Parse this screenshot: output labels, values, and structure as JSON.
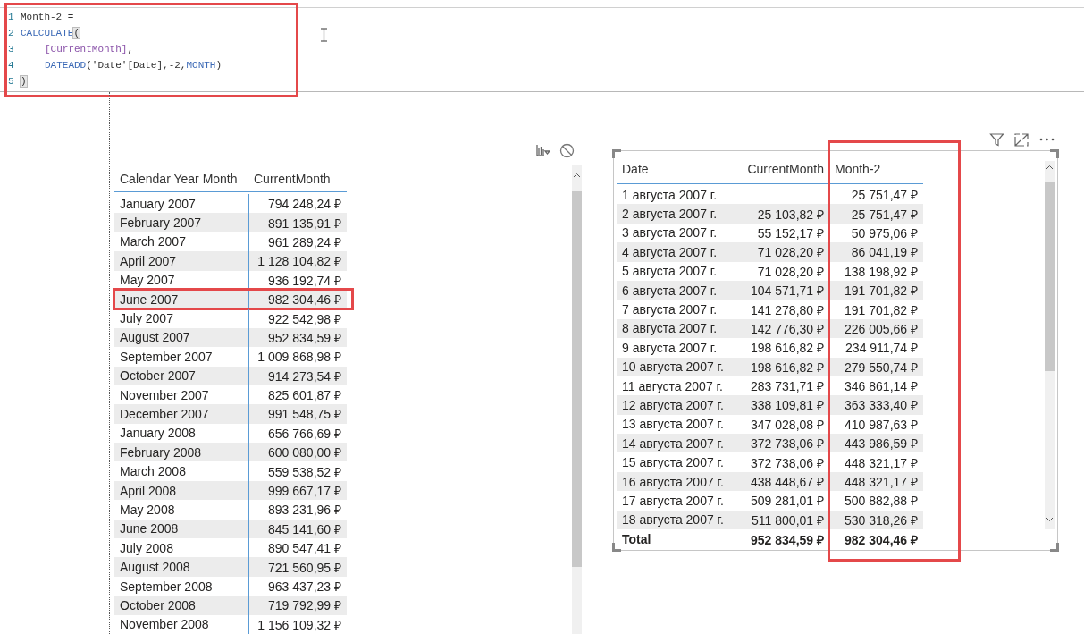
{
  "formula": {
    "highlighted": true,
    "lines": [
      {
        "number": "1",
        "indented": false,
        "tokens": [
          {
            "text": "Month-2 =",
            "kind": "plain"
          }
        ]
      },
      {
        "number": "2",
        "indented": false,
        "tokens": [
          {
            "text": "CALCULATE",
            "kind": "function"
          },
          {
            "text": "(",
            "kind": "bracket"
          }
        ]
      },
      {
        "number": "3",
        "indented": true,
        "tokens": [
          {
            "text": "[CurrentMonth]",
            "kind": "measure"
          },
          {
            "text": ",",
            "kind": "plain"
          }
        ]
      },
      {
        "number": "4",
        "indented": true,
        "tokens": [
          {
            "text": "DATEADD",
            "kind": "function"
          },
          {
            "text": "('Date'[Date],-2,",
            "kind": "plain"
          },
          {
            "text": "MONTH",
            "kind": "keyword"
          },
          {
            "text": ")",
            "kind": "plain"
          }
        ]
      },
      {
        "number": "5",
        "indented": false,
        "tokens": [
          {
            "text": ")",
            "kind": "bracket"
          }
        ]
      }
    ]
  },
  "left_table": {
    "columns": [
      "Calendar Year Month",
      "CurrentMonth"
    ],
    "rows": [
      {
        "cells": [
          "January 2007",
          "794 248,24 ₽"
        ],
        "highlighted": false
      },
      {
        "cells": [
          "February 2007",
          "891 135,91 ₽"
        ],
        "highlighted": false
      },
      {
        "cells": [
          "March 2007",
          "961 289,24 ₽"
        ],
        "highlighted": false
      },
      {
        "cells": [
          "April 2007",
          "1 128 104,82 ₽"
        ],
        "highlighted": false
      },
      {
        "cells": [
          "May 2007",
          "936 192,74 ₽"
        ],
        "highlighted": false
      },
      {
        "cells": [
          "June 2007",
          "982 304,46 ₽"
        ],
        "highlighted": true
      },
      {
        "cells": [
          "July 2007",
          "922 542,98 ₽"
        ],
        "highlighted": false
      },
      {
        "cells": [
          "August 2007",
          "952 834,59 ₽"
        ],
        "highlighted": false
      },
      {
        "cells": [
          "September 2007",
          "1 009 868,98 ₽"
        ],
        "highlighted": false
      },
      {
        "cells": [
          "October 2007",
          "914 273,54 ₽"
        ],
        "highlighted": false
      },
      {
        "cells": [
          "November 2007",
          "825 601,87 ₽"
        ],
        "highlighted": false
      },
      {
        "cells": [
          "December 2007",
          "991 548,75 ₽"
        ],
        "highlighted": false
      },
      {
        "cells": [
          "January 2008",
          "656 766,69 ₽"
        ],
        "highlighted": false
      },
      {
        "cells": [
          "February 2008",
          "600 080,00 ₽"
        ],
        "highlighted": false
      },
      {
        "cells": [
          "March 2008",
          "559 538,52 ₽"
        ],
        "highlighted": false
      },
      {
        "cells": [
          "April 2008",
          "999 667,17 ₽"
        ],
        "highlighted": false
      },
      {
        "cells": [
          "May 2008",
          "893 231,96 ₽"
        ],
        "highlighted": false
      },
      {
        "cells": [
          "June 2008",
          "845 141,60 ₽"
        ],
        "highlighted": false
      },
      {
        "cells": [
          "July 2008",
          "890 547,41 ₽"
        ],
        "highlighted": false
      },
      {
        "cells": [
          "August 2008",
          "721 560,95 ₽"
        ],
        "highlighted": false
      },
      {
        "cells": [
          "September 2008",
          "963 437,23 ₽"
        ],
        "highlighted": false
      },
      {
        "cells": [
          "October 2008",
          "719 792,99 ₽"
        ],
        "highlighted": false
      },
      {
        "cells": [
          "November 2008",
          "1 156 109,32 ₽"
        ],
        "highlighted": false
      }
    ]
  },
  "right_table": {
    "columns": [
      {
        "label": "Date",
        "highlighted": false
      },
      {
        "label": "CurrentMonth",
        "highlighted": false
      },
      {
        "label": "Month-2",
        "highlighted": true
      }
    ],
    "rows": [
      [
        "1 августа 2007 г.",
        "",
        "25 751,47 ₽"
      ],
      [
        "2 августа 2007 г.",
        "25 103,82 ₽",
        "25 751,47 ₽"
      ],
      [
        "3 августа 2007 г.",
        "55 152,17 ₽",
        "50 975,06 ₽"
      ],
      [
        "4 августа 2007 г.",
        "71 028,20 ₽",
        "86 041,19 ₽"
      ],
      [
        "5 августа 2007 г.",
        "71 028,20 ₽",
        "138 198,92 ₽"
      ],
      [
        "6 августа 2007 г.",
        "104 571,71 ₽",
        "191 701,82 ₽"
      ],
      [
        "7 августа 2007 г.",
        "141 278,80 ₽",
        "191 701,82 ₽"
      ],
      [
        "8 августа 2007 г.",
        "142 776,30 ₽",
        "226 005,66 ₽"
      ],
      [
        "9 августа 2007 г.",
        "198 616,82 ₽",
        "234 911,74 ₽"
      ],
      [
        "10 августа 2007 г.",
        "198 616,82 ₽",
        "279 550,74 ₽"
      ],
      [
        "11 августа 2007 г.",
        "283 731,71 ₽",
        "346 861,14 ₽"
      ],
      [
        "12 августа 2007 г.",
        "338 109,81 ₽",
        "363 333,40 ₽"
      ],
      [
        "13 августа 2007 г.",
        "347 028,08 ₽",
        "410 987,63 ₽"
      ],
      [
        "14 августа 2007 г.",
        "372 738,06 ₽",
        "443 986,59 ₽"
      ],
      [
        "15 августа 2007 г.",
        "372 738,06 ₽",
        "448 321,17 ₽"
      ],
      [
        "16 августа 2007 г.",
        "438 448,67 ₽",
        "448 321,17 ₽"
      ],
      [
        "17 августа 2007 г.",
        "509 281,01 ₽",
        "500 882,88 ₽"
      ],
      [
        "18 августа 2007 г.",
        "511 800,01 ₽",
        "530 318,26 ₽"
      ]
    ],
    "total": [
      "Total",
      "952 834,59 ₽",
      "982 304,46 ₽"
    ]
  }
}
